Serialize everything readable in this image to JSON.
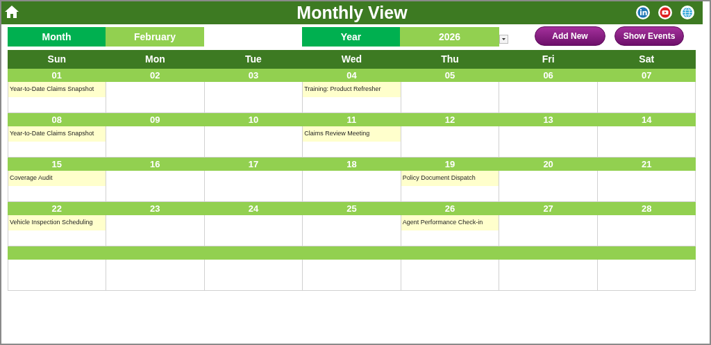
{
  "header": {
    "title": "Monthly View"
  },
  "controls": {
    "month_label": "Month",
    "month_value": "February",
    "year_label": "Year",
    "year_value": "2026",
    "buttons": [
      "Add New",
      "Show Events"
    ]
  },
  "weekdays": [
    "Sun",
    "Mon",
    "Tue",
    "Wed",
    "Thu",
    "Fri",
    "Sat"
  ],
  "weeks": [
    {
      "days": [
        {
          "date": "01",
          "event": "Year-to-Date Claims Snapshot"
        },
        {
          "date": "02"
        },
        {
          "date": "03"
        },
        {
          "date": "04",
          "event": "Training: Product Refresher"
        },
        {
          "date": "05"
        },
        {
          "date": "06"
        },
        {
          "date": "07"
        }
      ]
    },
    {
      "days": [
        {
          "date": "08",
          "event": "Year-to-Date Claims Snapshot"
        },
        {
          "date": "09"
        },
        {
          "date": "10"
        },
        {
          "date": "11",
          "event": "Claims Review Meeting"
        },
        {
          "date": "12"
        },
        {
          "date": "13"
        },
        {
          "date": "14"
        }
      ]
    },
    {
      "days": [
        {
          "date": "15",
          "event": "Coverage Audit"
        },
        {
          "date": "16"
        },
        {
          "date": "17"
        },
        {
          "date": "18"
        },
        {
          "date": "19",
          "event": "Policy Document Dispatch"
        },
        {
          "date": "20"
        },
        {
          "date": "21"
        }
      ]
    },
    {
      "days": [
        {
          "date": "22",
          "event": "Vehicle Inspection Scheduling"
        },
        {
          "date": "23"
        },
        {
          "date": "24"
        },
        {
          "date": "25"
        },
        {
          "date": "26",
          "event": "Agent Performance Check-in"
        },
        {
          "date": "27"
        },
        {
          "date": "28"
        }
      ]
    },
    {
      "kind": "blank"
    }
  ]
}
